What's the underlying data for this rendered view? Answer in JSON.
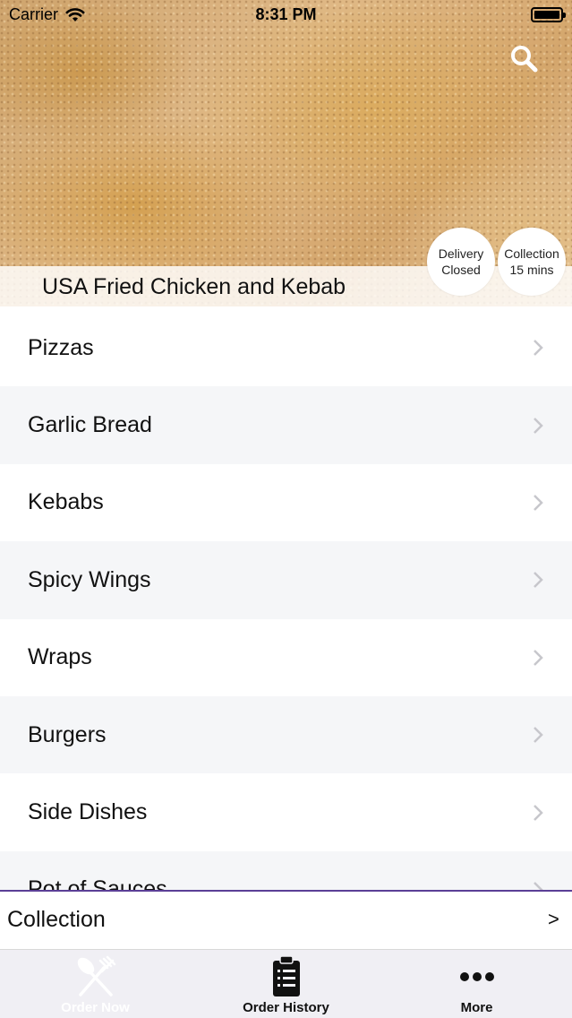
{
  "status_bar": {
    "carrier": "Carrier",
    "time": "8:31 PM"
  },
  "restaurant": {
    "name": "USA Fried Chicken and Kebab",
    "delivery_badge": {
      "line1": "Delivery",
      "line2": "Closed"
    },
    "collection_badge": {
      "line1": "Collection",
      "line2": "15 mins"
    }
  },
  "menu": {
    "items": [
      {
        "label": "Pizzas"
      },
      {
        "label": "Garlic Bread"
      },
      {
        "label": "Kebabs"
      },
      {
        "label": "Spicy Wings"
      },
      {
        "label": "Wraps"
      },
      {
        "label": "Burgers"
      },
      {
        "label": "Side Dishes"
      },
      {
        "label": "Pot of Sauces"
      }
    ]
  },
  "order_mode": {
    "label": "Collection",
    "arrow": ">"
  },
  "tabs": [
    {
      "label": "Order Now",
      "icon": "fork-knife-icon",
      "active": true
    },
    {
      "label": "Order History",
      "icon": "clipboard-icon",
      "active": false
    },
    {
      "label": "More",
      "icon": "ellipsis-icon",
      "active": false
    }
  ],
  "colors": {
    "accent_line": "#5b3f96",
    "tab_bar_bg": "#f0eff4",
    "alt_row_bg": "#f5f6f8"
  }
}
